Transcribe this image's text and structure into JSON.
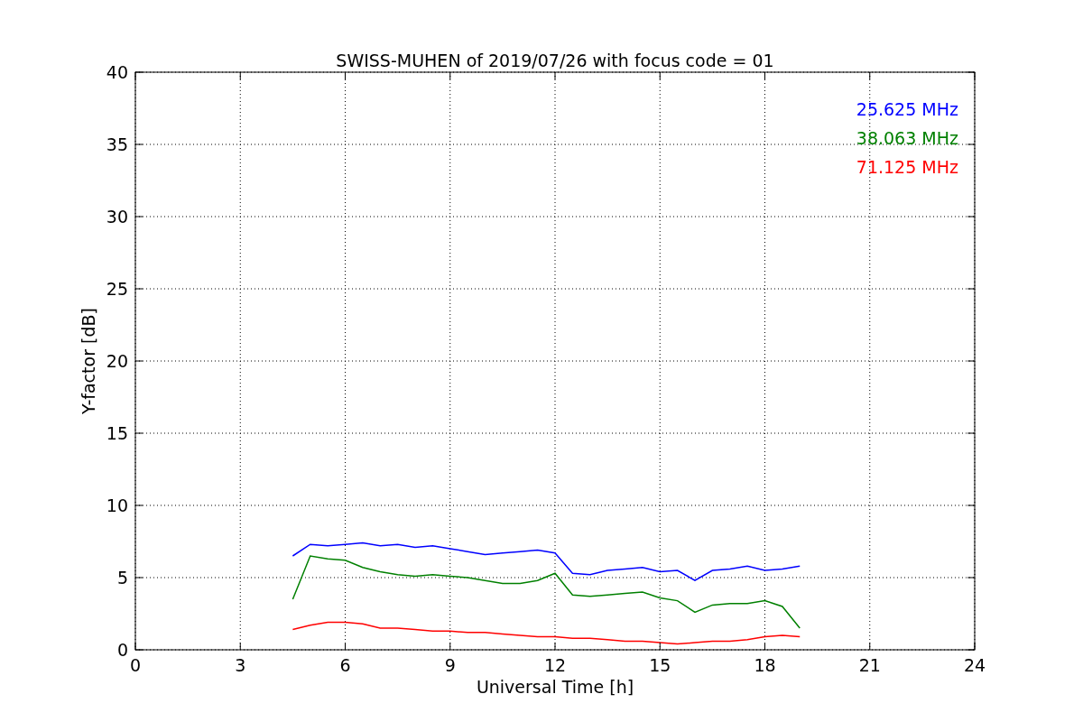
{
  "chart": {
    "chart_data": {
      "type": "line",
      "title": "SWISS-MUHEN of 2019/07/26 with focus code = 01",
      "xlabel": "Universal Time [h]",
      "ylabel": "Y-factor [dB]",
      "x": [
        4.5,
        5,
        5.5,
        6,
        6.5,
        7,
        7.5,
        8,
        8.5,
        9,
        9.5,
        10,
        10.5,
        11,
        11.5,
        12,
        12.5,
        13,
        13.5,
        14,
        14.5,
        15,
        15.5,
        16,
        16.5,
        17,
        17.5,
        18,
        18.5,
        19
      ],
      "series": [
        {
          "name": "25.625 MHz",
          "color": "#0000ff",
          "values": [
            6.5,
            7.3,
            7.2,
            7.3,
            7.4,
            7.2,
            7.3,
            7.1,
            7.2,
            7.0,
            6.8,
            6.6,
            6.7,
            6.8,
            6.9,
            6.7,
            5.3,
            5.2,
            5.5,
            5.6,
            5.7,
            5.4,
            5.5,
            4.8,
            5.5,
            5.6,
            5.8,
            5.5,
            5.6,
            5.8
          ]
        },
        {
          "name": "38.063 MHz",
          "color": "#008000",
          "values": [
            3.5,
            6.5,
            6.3,
            6.2,
            5.7,
            5.4,
            5.2,
            5.1,
            5.2,
            5.1,
            5.0,
            4.8,
            4.6,
            4.6,
            4.8,
            5.3,
            3.8,
            3.7,
            3.8,
            3.9,
            4.0,
            3.6,
            3.4,
            2.6,
            3.1,
            3.2,
            3.2,
            3.4,
            3.0,
            1.5
          ]
        },
        {
          "name": "71.125 MHz",
          "color": "#ff0000",
          "values": [
            1.4,
            1.7,
            1.9,
            1.9,
            1.8,
            1.5,
            1.5,
            1.4,
            1.3,
            1.3,
            1.2,
            1.2,
            1.1,
            1.0,
            0.9,
            0.9,
            0.8,
            0.8,
            0.7,
            0.6,
            0.6,
            0.5,
            0.4,
            0.5,
            0.6,
            0.6,
            0.7,
            0.9,
            1.0,
            0.9
          ]
        }
      ],
      "grid": true,
      "xlim": [
        0,
        24
      ],
      "ylim": [
        0,
        40
      ],
      "xticks": [
        0,
        3,
        6,
        9,
        12,
        15,
        18,
        21,
        24
      ],
      "yticks": [
        0,
        5,
        10,
        15,
        20,
        25,
        30,
        35,
        40
      ]
    }
  }
}
